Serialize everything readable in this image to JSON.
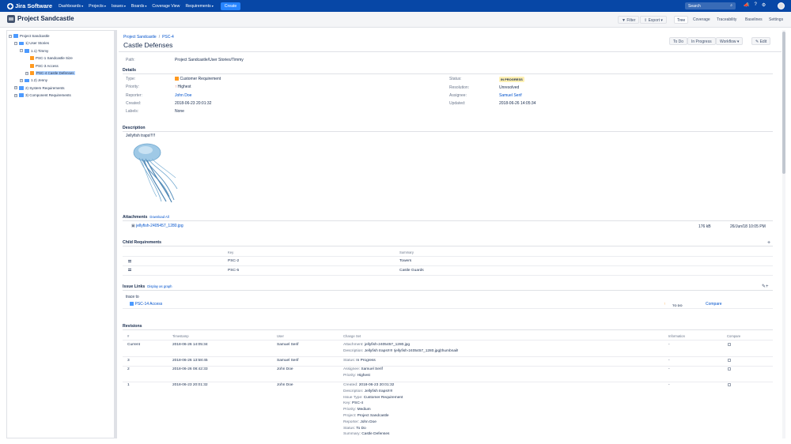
{
  "topnav": {
    "logo_text": "Jira Software",
    "items": [
      "Dashboards",
      "Projects",
      "Issues",
      "Boards",
      "Coverage View",
      "Requirements"
    ],
    "create_label": "Create",
    "search_placeholder": "Search",
    "icons": [
      "notifications-icon",
      "help-icon",
      "settings-icon"
    ]
  },
  "project": {
    "title": "Project Sandcastle",
    "toolbar": {
      "filter_label": "Filter",
      "export_label": "Export",
      "tabs": [
        "Tree",
        "Coverage",
        "Traceability",
        "Baselines",
        "Settings"
      ],
      "active_tab": "Tree"
    }
  },
  "tree": {
    "items": [
      {
        "label": "Project Sandcastle",
        "level": 0,
        "toggle": "−",
        "kind": "folder"
      },
      {
        "label": "1) User Stories",
        "level": 1,
        "toggle": "−",
        "kind": "folder"
      },
      {
        "label": "1.1) Timmy",
        "level": 2,
        "toggle": "−",
        "kind": "folder"
      },
      {
        "label": "PSC-1 Sandcastle Size",
        "level": 3,
        "toggle": "",
        "kind": "req"
      },
      {
        "label": "PSC-3 Access",
        "level": 3,
        "toggle": "",
        "kind": "req"
      },
      {
        "label": "PSC-4 Castle Defenses",
        "level": 3,
        "toggle": "+",
        "kind": "req",
        "selected": true
      },
      {
        "label": "1.2) Jenny",
        "level": 2,
        "toggle": "+",
        "kind": "folder"
      },
      {
        "label": "2) System Requirements",
        "level": 1,
        "toggle": "+",
        "kind": "folder"
      },
      {
        "label": "3) Component Requirements",
        "level": 1,
        "toggle": "+",
        "kind": "folder"
      }
    ]
  },
  "issue": {
    "breadcrumb": [
      "Project Sandcastle",
      "PSC-4"
    ],
    "title": "Castle Defenses",
    "actions": [
      "To Do",
      "In Progress",
      "Workflow",
      "Edit"
    ],
    "path_label": "Path:",
    "path_value": "Project Sandcastle/User Stories/Timmy",
    "details_title": "Details",
    "fields_left": [
      {
        "label": "Type:",
        "value": "Customer Requirement"
      },
      {
        "label": "Priority:",
        "value": "Highest"
      },
      {
        "label": "Reporter:",
        "value": "John Doe"
      },
      {
        "label": "Created:",
        "value": "2018-06-23 20:01:32"
      },
      {
        "label": "Labels:",
        "value": "None"
      }
    ],
    "fields_right": [
      {
        "label": "Status:",
        "value": "IN PROGRESS"
      },
      {
        "label": "Resolution:",
        "value": "Unresolved"
      },
      {
        "label": "Assignee:",
        "value": "Samuel Serif"
      },
      {
        "label": "Updated:",
        "value": "2018-06-26 14:05:34"
      }
    ],
    "description_title": "Description",
    "description_text": "Jellyfish traps!!!!!",
    "attachments_title": "Attachments",
    "attachments_download": "Download All",
    "attachment": {
      "name": "jellyfish-2405457_1280.jpg",
      "size": "176 kB",
      "date": "26/Jun/18 10:05 PM"
    },
    "child_title": "Child Requirements",
    "child_headers": [
      "Key",
      "Summary"
    ],
    "children": [
      {
        "key": "PSC-2",
        "summary": "Towers"
      },
      {
        "key": "PSC-5",
        "summary": "Castle Guards"
      }
    ],
    "links_title": "Issue Links",
    "links_graph": "Display as graph",
    "link_type": "trace to",
    "link_item": {
      "key": "PSC-14 Access",
      "status": "TO DO",
      "compare": "Compare"
    },
    "revisions_title": "Revisions",
    "revision_headers": [
      "#",
      "Timestamp",
      "User",
      "Change Set",
      "Information",
      "Compare"
    ],
    "revisions": [
      {
        "num": "Current",
        "ts": "2018-06-26 14:05:34",
        "user": "Samuel Serif",
        "info": "-",
        "changes": [
          [
            "Attachment:",
            "jellyfish-2405457_1280.jpg"
          ],
          [
            "Description:",
            "Jellyfish traps!!!!! !jellyfish-2405457_1280.jpg|thumbnail!"
          ]
        ]
      },
      {
        "num": "3",
        "ts": "2018-06-26 13:58:45",
        "user": "Samuel Serif",
        "info": "-",
        "changes": [
          [
            "Status:",
            "In Progress"
          ]
        ]
      },
      {
        "num": "2",
        "ts": "2018-06-26 08:42:33",
        "user": "John Doe",
        "info": "-",
        "changes": [
          [
            "Assignee:",
            "Samuel Serif"
          ],
          [
            "Priority:",
            "Highest"
          ]
        ]
      },
      {
        "num": "1",
        "ts": "2018-06-23 20:01:32",
        "user": "John Doe",
        "info": "-",
        "changes": [
          [
            "Created:",
            "2018-06-23 20:01:32"
          ],
          [
            "Description:",
            "Jellyfish traps!!!!!"
          ],
          [
            "Issue Type:",
            "Customer Requirement"
          ],
          [
            "Key:",
            "PSC-4"
          ],
          [
            "Priority:",
            "Medium"
          ],
          [
            "Project:",
            "Project Sandcastle"
          ],
          [
            "Reporter:",
            "John Doe"
          ],
          [
            "Status:",
            "To Do"
          ],
          [
            "Summary:",
            "Castle Defenses"
          ]
        ]
      }
    ]
  }
}
